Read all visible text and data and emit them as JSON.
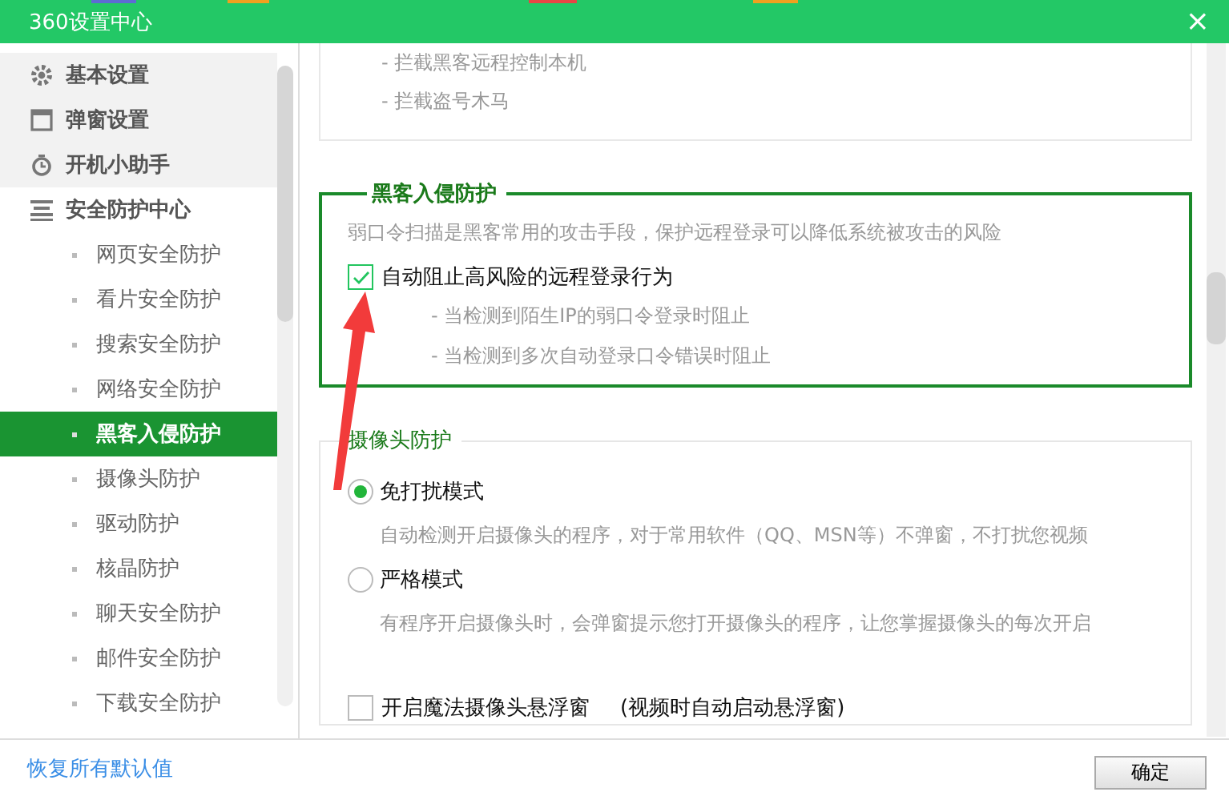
{
  "window": {
    "title": "360设置中心",
    "close": "×"
  },
  "sidebar": {
    "items": [
      {
        "label": "基本设置",
        "selected": false
      },
      {
        "label": "弹窗设置",
        "selected": false
      },
      {
        "label": "开机小助手",
        "selected": false
      },
      {
        "label": "安全防护中心",
        "selected": false,
        "children": [
          {
            "label": "网页安全防护",
            "selected": false
          },
          {
            "label": "看片安全防护",
            "selected": false
          },
          {
            "label": "搜索安全防护",
            "selected": false
          },
          {
            "label": "网络安全防护",
            "selected": false
          },
          {
            "label": "黑客入侵防护",
            "selected": true
          },
          {
            "label": "摄像头防护",
            "selected": false
          },
          {
            "label": "驱动防护",
            "selected": false
          },
          {
            "label": "核晶防护",
            "selected": false
          },
          {
            "label": "聊天安全防护",
            "selected": false
          },
          {
            "label": "邮件安全防护",
            "selected": false
          },
          {
            "label": "下载安全防护",
            "selected": false
          }
        ]
      }
    ]
  },
  "content": {
    "previous_section": {
      "lines": [
        "- 拦截黑客远程控制本机",
        "- 拦截盗号木马"
      ]
    },
    "hacker_section": {
      "title": "黑客入侵防护",
      "description": "弱口令扫描是黑客常用的攻击手段，保护远程登录可以降低系统被攻击的风险",
      "option": {
        "label": "自动阻止高风险的远程登录行为",
        "checked": true
      },
      "details": [
        "- 当检测到陌生IP的弱口令登录时阻止",
        "- 当检测到多次自动登录口令错误时阻止"
      ]
    },
    "camera_section": {
      "title": "摄像头防护",
      "modes": [
        {
          "label": "免打扰模式",
          "selected": true,
          "description": "自动检测开启摄像头的程序，对于常用软件（QQ、MSN等）不弹窗，不打扰您视频"
        },
        {
          "label": "严格模式",
          "selected": false,
          "description": "有程序开启摄像头时，会弹窗提示您打开摄像头的程序，让您掌握摄像头的每次开启"
        }
      ],
      "floating_window": {
        "label": "开启魔法摄像头悬浮窗",
        "note": "(视频时自动启动悬浮窗)",
        "checked": false
      }
    }
  },
  "footer": {
    "restore_link": "恢复所有默认值",
    "ok_button": "确定"
  }
}
